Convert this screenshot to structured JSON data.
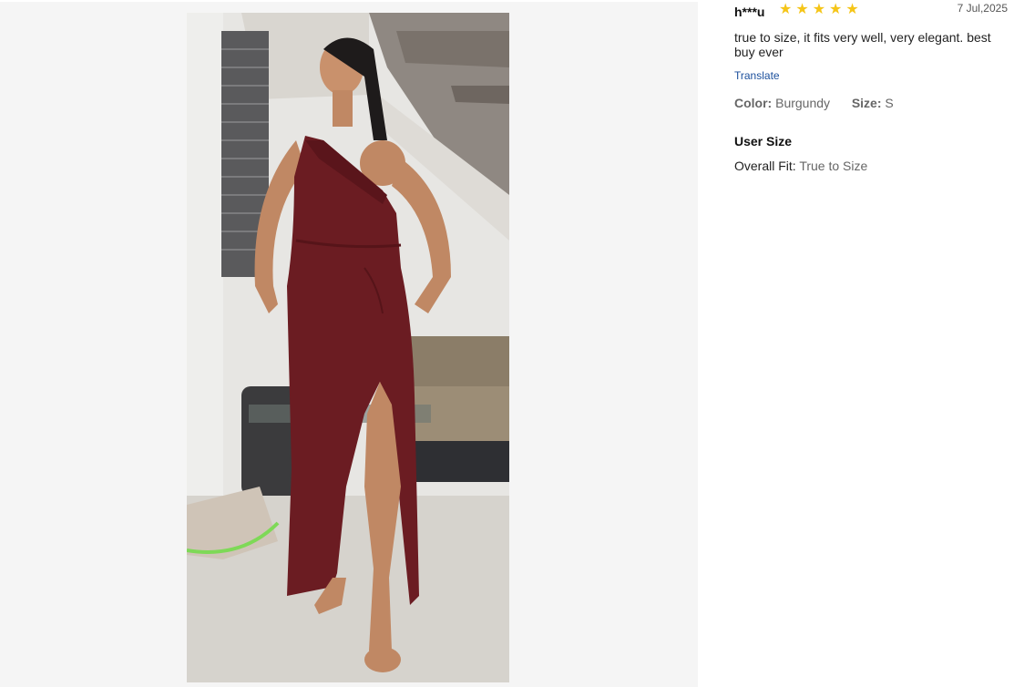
{
  "review": {
    "username": "h***u",
    "rating": 5,
    "stars": [
      "★",
      "★",
      "★",
      "★",
      "★"
    ],
    "star_color": "#f5c518",
    "date": "7 Jul,2025",
    "text": "true to size, it fits very well, very elegant. best buy ever",
    "translate_label": "Translate",
    "color_label": "Color:",
    "color_value": "Burgundy",
    "size_label": "Size:",
    "size_value": "S",
    "user_size_title": "User Size",
    "overall_fit_label": "Overall Fit:",
    "overall_fit_value": "True to Size"
  },
  "colors": {
    "gallery_bg": "#f5f5f5",
    "link": "#1b4f9c",
    "dress": "#6b1c22"
  }
}
